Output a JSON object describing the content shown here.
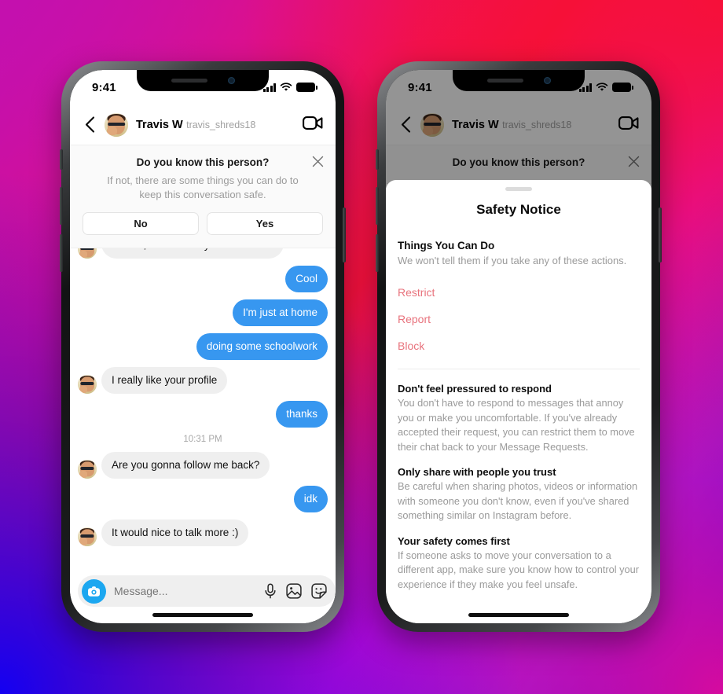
{
  "background": {
    "gradient_colors": [
      "#C212A8",
      "#E6107E",
      "#F5113E",
      "#D90CD0",
      "#7A1AE8",
      "#1500F0"
    ]
  },
  "theme": {
    "bubble_out": "#3797F0",
    "bubble_in": "#EFEFEF",
    "action_red": "#E8737D",
    "muted_text": "#9A9A9A",
    "camera_blue": "#1CA7F0"
  },
  "status_bar": {
    "time": "9:41",
    "signal_icon": "cellular-bars-icon",
    "wifi_icon": "wifi-icon",
    "battery_icon": "battery-full-icon"
  },
  "chat_header": {
    "back_icon": "back-chevron-icon",
    "avatar_icon": "avatar-image",
    "name": "Travis W",
    "handle": "travis_shreds18",
    "video_icon": "video-call-icon"
  },
  "know_card": {
    "title": "Do you know this person?",
    "subtitle": "If not, there are some things you can do to keep this conversation safe.",
    "close_icon": "close-x-icon",
    "no_label": "No",
    "yes_label": "Yes"
  },
  "conversation": {
    "messages": [
      {
        "side": "in",
        "text": "I'm having dinner with some friends, what about you?",
        "clipped": true
      },
      {
        "side": "out",
        "text": "Cool"
      },
      {
        "side": "out",
        "text": "I'm just at home"
      },
      {
        "side": "out",
        "text": "doing some schoolwork"
      },
      {
        "side": "in",
        "text": "I really like your profile"
      },
      {
        "side": "out",
        "text": "thanks"
      }
    ],
    "timestamp": "10:31 PM",
    "messages_after": [
      {
        "side": "in",
        "text": "Are you gonna follow me back?"
      },
      {
        "side": "out",
        "text": "idk"
      },
      {
        "side": "in",
        "text": "It would nice to talk more :)"
      }
    ]
  },
  "composer": {
    "camera_icon": "camera-icon",
    "placeholder": "Message...",
    "mic_icon": "microphone-icon",
    "gallery_icon": "photo-gallery-icon",
    "sticker_icon": "sticker-icon"
  },
  "safety_sheet": {
    "handle_icon": "drag-handle-icon",
    "title": "Safety Notice",
    "section_heading": "Things You Can Do",
    "section_sub": "We won't tell them if you take any of these actions.",
    "actions": [
      {
        "label": "Restrict"
      },
      {
        "label": "Report"
      },
      {
        "label": "Block"
      }
    ],
    "tips": [
      {
        "head": "Don't feel pressured to respond",
        "text": "You don't have to respond to messages that annoy you or make you uncomfortable. If you've already accepted their request, you can restrict them to move their chat back to your Message Requests."
      },
      {
        "head": "Only share with people you trust",
        "text": "Be careful when sharing photos, videos or information with someone you don't know, even if you've shared something similar on Instagram before."
      },
      {
        "head": "Your safety comes first",
        "text": "If someone asks to move your conversation to a different app, make sure you know how to control your experience if they make you feel unsafe."
      }
    ]
  }
}
